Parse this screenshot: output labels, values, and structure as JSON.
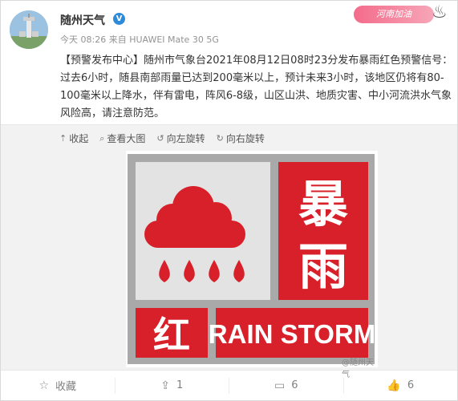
{
  "header": {
    "user_name": "随州天气",
    "verified_mark": "V",
    "time": "今天 08:26",
    "source": "来自 HUAWEI Mate 30 5G",
    "topic_badge": "河南加油"
  },
  "post": {
    "text": "【预警发布中心】随州市气象台2021年08月12日08时23分发布暴雨红色预警信号：过去6小时，随县南部雨量已达到200毫米以上，预计未来3小时，该地区仍将有80-100毫米以上降水，伴有雷电，阵风6-8级，山区山洪、地质灾害、中小河流洪水气象风险高，请注意防范。"
  },
  "image_tools": {
    "collapse": "收起",
    "view_large": "查看大图",
    "rotate_left": "向左旋转",
    "rotate_right": "向右旋转"
  },
  "warning_sign": {
    "title_top": "暴",
    "title_bottom": "雨",
    "level": "红",
    "english": "RAIN STORM",
    "watermark": "@随州天气",
    "colors": {
      "red": "#d8202a",
      "dark_red": "#b5151f",
      "panel": "#e3e3e3",
      "frame": "#a9a9a9"
    }
  },
  "footer": {
    "favorite": "收藏",
    "repost_count": "1",
    "comment_count": "6",
    "like_count": "6"
  }
}
